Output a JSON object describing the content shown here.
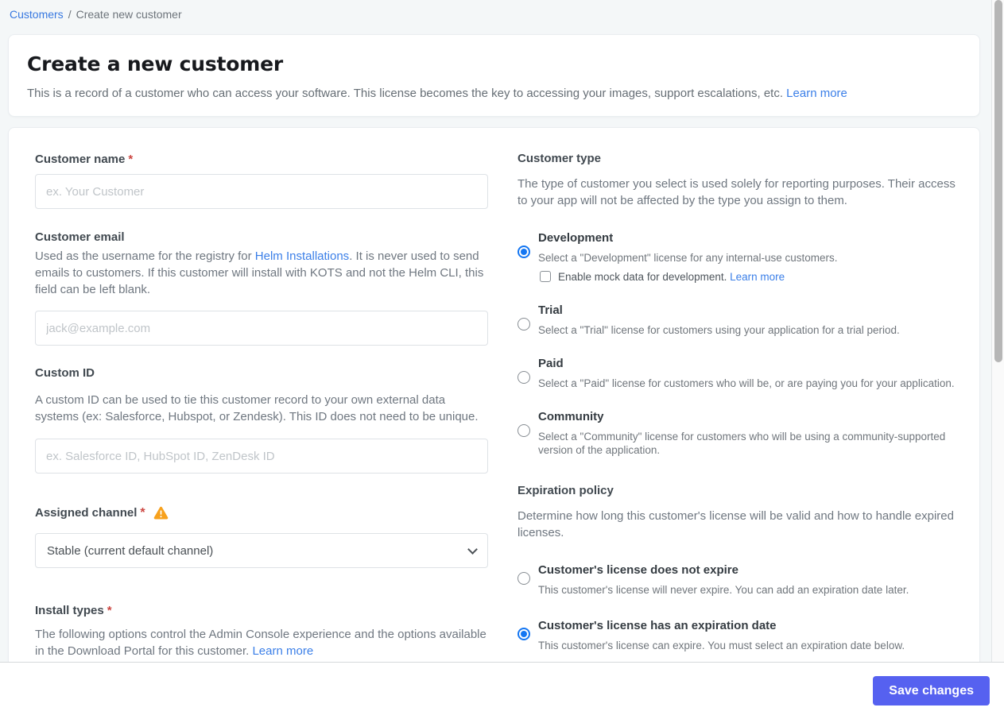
{
  "breadcrumb": {
    "link": "Customers",
    "separator": "/",
    "current": "Create new customer"
  },
  "header": {
    "title": "Create a new customer",
    "description": "This is a record of a customer who can access your software. This license becomes the key to accessing your images, support escalations, etc.",
    "learn_more": "Learn more"
  },
  "form": {
    "customer_name": {
      "label": "Customer name",
      "required": "*",
      "placeholder": "ex. Your Customer",
      "value": ""
    },
    "customer_email": {
      "label": "Customer email",
      "description_before_link": "Used as the username for the registry for ",
      "link": "Helm Installations",
      "description_after_link": ". It is never used to send emails to customers. If this customer will install with KOTS and not the Helm CLI, this field can be left blank.",
      "placeholder": "jack@example.com",
      "value": ""
    },
    "custom_id": {
      "label": "Custom ID",
      "description": "A custom ID can be used to tie this customer record to your own external data systems (ex: Salesforce, Hubspot, or Zendesk). This ID does not need to be unique.",
      "placeholder": "ex. Salesforce ID, HubSpot ID, ZenDesk ID",
      "value": ""
    },
    "assigned_channel": {
      "label": "Assigned channel",
      "required": "*",
      "has_warning": true,
      "selected_option": "Stable (current default channel)"
    },
    "install_types": {
      "label": "Install types",
      "required": "*",
      "description": "The following options control the Admin Console experience and the options available in the Download Portal for this customer.",
      "learn_more": "Learn more"
    }
  },
  "customer_type": {
    "label": "Customer type",
    "description": "The type of customer you select is used solely for reporting purposes. Their access to your app will not be affected by the type you assign to them.",
    "options": [
      {
        "title": "Development",
        "description": "Select a \"Development\" license for any internal-use customers.",
        "selected": true,
        "checkbox_label": "Enable mock data for development.",
        "checkbox_link": "Learn more",
        "checkbox_checked": false
      },
      {
        "title": "Trial",
        "description": "Select a \"Trial\" license for customers using your application for a trial period.",
        "selected": false
      },
      {
        "title": "Paid",
        "description": "Select a \"Paid\" license for customers who will be, or are paying you for your application.",
        "selected": false
      },
      {
        "title": "Community",
        "description": "Select a \"Community\" license for customers who will be using a community-supported version of the application.",
        "selected": false
      }
    ]
  },
  "expiration_policy": {
    "label": "Expiration policy",
    "description": "Determine how long this customer's license will be valid and how to handle expired licenses.",
    "options": [
      {
        "title": "Customer's license does not expire",
        "description": "This customer's license will never expire. You can add an expiration date later.",
        "selected": false
      },
      {
        "title": "Customer's license has an expiration date",
        "description": "This customer's license can expire. You must select an expiration date below.",
        "selected": true
      }
    ]
  },
  "footer": {
    "save_label": "Save changes"
  },
  "colors": {
    "link_blue": "#3b7fe8",
    "radio_selected_blue": "#1476f2",
    "save_button": "#5661f0",
    "warning_orange": "#f7a11d",
    "required_red": "#cc4641",
    "page_background": "#f4f7f8"
  }
}
